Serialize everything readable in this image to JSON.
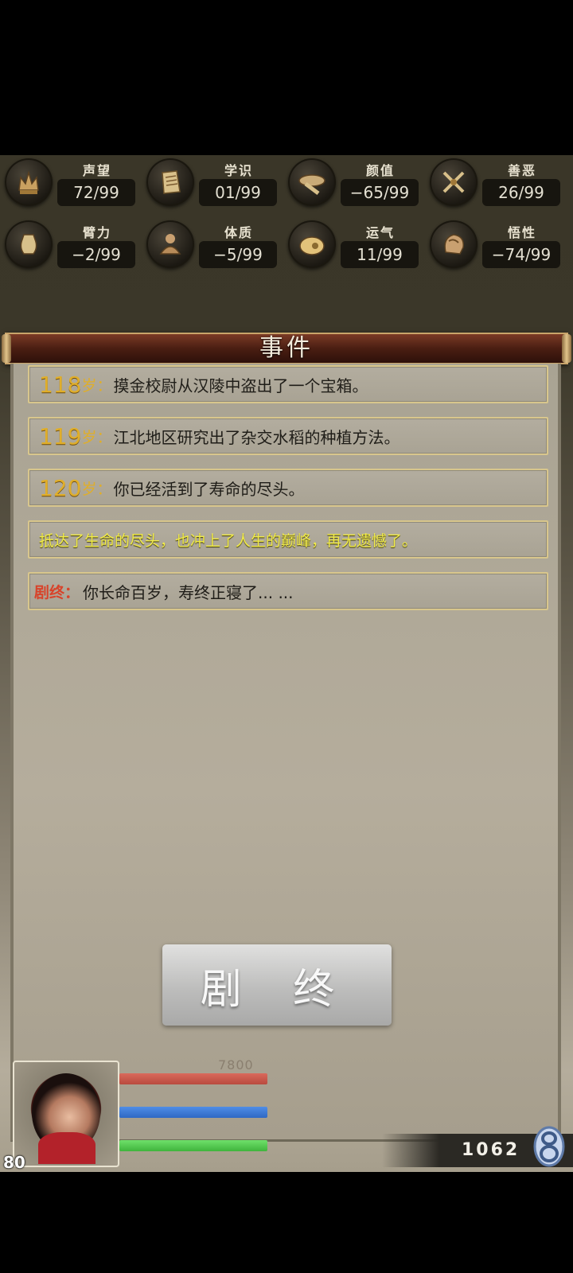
{
  "stats": [
    {
      "name": "声望",
      "value": "72/99",
      "icon": "crown-icon"
    },
    {
      "name": "学识",
      "value": "01/99",
      "icon": "scroll-icon"
    },
    {
      "name": "颜值",
      "value": "−65/99",
      "icon": "hat-icon"
    },
    {
      "name": "善恶",
      "value": "26/99",
      "icon": "crossed-swords-icon"
    },
    {
      "name": "臂力",
      "value": "−2/99",
      "icon": "jar-icon"
    },
    {
      "name": "体质",
      "value": "−5/99",
      "icon": "buddha-icon"
    },
    {
      "name": "运气",
      "value": "11/99",
      "icon": "bag-icon"
    },
    {
      "name": "悟性",
      "value": "−74/99",
      "icon": "head-icon"
    }
  ],
  "panel": {
    "title": "事件"
  },
  "events": [
    {
      "age": "118",
      "unit": "岁：",
      "text": "摸金校尉从汉陵中盗出了一个宝箱。"
    },
    {
      "age": "119",
      "unit": "岁：",
      "text": "江北地区研究出了杂交水稻的种植方法。"
    },
    {
      "age": "120",
      "unit": "岁：",
      "text": "你已经活到了寿命的尽头。"
    }
  ],
  "summary_text": "抵达了生命的尽头，也冲上了人生的巅峰，再无遗憾了。",
  "ending": {
    "label": "剧终：",
    "text": "你长命百岁，寿终正寝了... ..."
  },
  "end_button": "剧 终",
  "player": {
    "level": "80",
    "hp_text": "7800"
  },
  "currency": {
    "amount": "1062"
  },
  "colors": {
    "hp": "#c9594b",
    "mp": "#3f7ad8",
    "sp": "#55cc52",
    "age": "#e0ae2a",
    "summary": "#f2ec4a",
    "ending": "#d8432a"
  }
}
